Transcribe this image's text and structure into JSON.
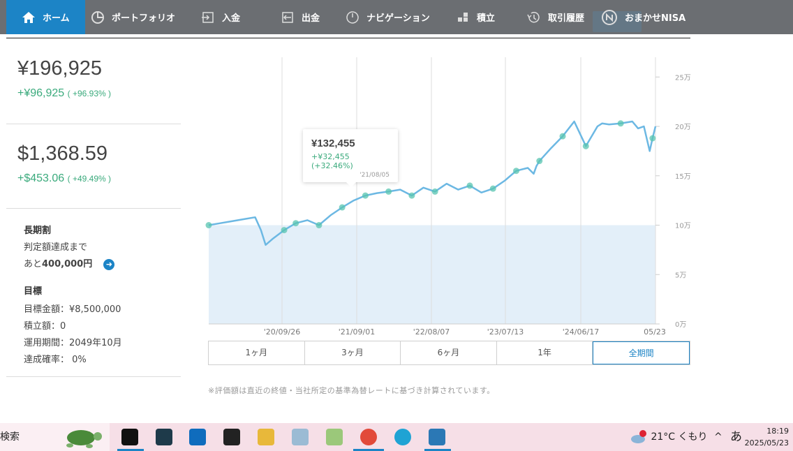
{
  "nav": {
    "items": [
      {
        "label": "ホーム",
        "icon": "home-icon",
        "active": true
      },
      {
        "label": "ポートフォリオ",
        "icon": "pie-chart-icon"
      },
      {
        "label": "入金",
        "icon": "deposit-icon"
      },
      {
        "label": "出金",
        "icon": "withdraw-icon"
      },
      {
        "label": "ナビゲーション",
        "icon": "navigation-icon"
      },
      {
        "label": "積立",
        "icon": "blocks-icon"
      },
      {
        "label": "取引履歴",
        "icon": "history-icon"
      },
      {
        "label": "おまかせNISA",
        "icon": "nisa-logo-icon"
      }
    ]
  },
  "summary": {
    "jpy_value": "¥196,925",
    "jpy_gain": "+¥96,925",
    "jpy_gain_pct": "( +96.93% )",
    "usd_value": "$1,368.59",
    "usd_gain": "+$453.06",
    "usd_gain_pct": "( +49.49% )"
  },
  "plan": {
    "title": "長期割",
    "line1": "判定額達成まで",
    "remaining_prefix": "あと",
    "remaining_amount": "400,000円",
    "goal_title": "目標",
    "goal_amount": "目標金額：¥8,500,000",
    "monthly": "積立額：0",
    "period": "運用期間：2049年10月",
    "probability": "達成確率： 0%"
  },
  "tooltip": {
    "value": "¥132,455",
    "gain": "+¥32,455 (+32.46%)",
    "date": "'21/08/05"
  },
  "range_tabs": [
    "1ヶ月",
    "3ヶ月",
    "6ヶ月",
    "1年",
    "全期間"
  ],
  "active_range": "全期間",
  "note": "※評価額は直近の終値・当社所定の基準為替レートに基づき計算されています。",
  "chart_data": {
    "type": "line",
    "x_tick_labels": [
      "'20/09/26",
      "'21/09/01",
      "'22/08/07",
      "'23/07/13",
      "'24/06/17",
      "05/23"
    ],
    "y_tick_labels": [
      "0万",
      "5万",
      "10万",
      "15万",
      "20万",
      "25万"
    ],
    "ylim": [
      0,
      270000
    ],
    "series": [
      {
        "color": "#6cb8e3",
        "x": [
          0,
          2,
          4,
          6,
          8,
          9,
          9.8,
          11,
          13,
          15,
          17,
          19,
          21,
          23,
          25,
          27,
          29,
          31,
          33,
          35,
          37,
          39,
          41,
          43,
          45,
          47,
          49,
          51,
          53,
          55,
          56,
          56.5,
          57,
          59,
          61,
          63,
          65,
          67,
          67.8,
          69,
          71,
          73,
          74,
          75,
          76,
          76.5,
          77
        ],
        "values": [
          100000,
          102000,
          104000,
          106000,
          108000,
          95000,
          80000,
          86000,
          95000,
          102000,
          105000,
          100000,
          110000,
          118000,
          125000,
          130000,
          132455,
          134000,
          136000,
          130000,
          138000,
          134000,
          142000,
          136000,
          140000,
          133000,
          137000,
          145000,
          155000,
          158000,
          152000,
          160000,
          165000,
          178000,
          190000,
          205000,
          180000,
          200000,
          203000,
          202000,
          203000,
          205000,
          198000,
          200000,
          175000,
          188000,
          200000
        ]
      }
    ],
    "principal_level": 100000,
    "grid": true,
    "legend": "none"
  },
  "taskbar": {
    "search_label": "検索",
    "weather": "21°C くもり",
    "ime": "あ",
    "time": "18:19",
    "date": "2025/05/23"
  }
}
